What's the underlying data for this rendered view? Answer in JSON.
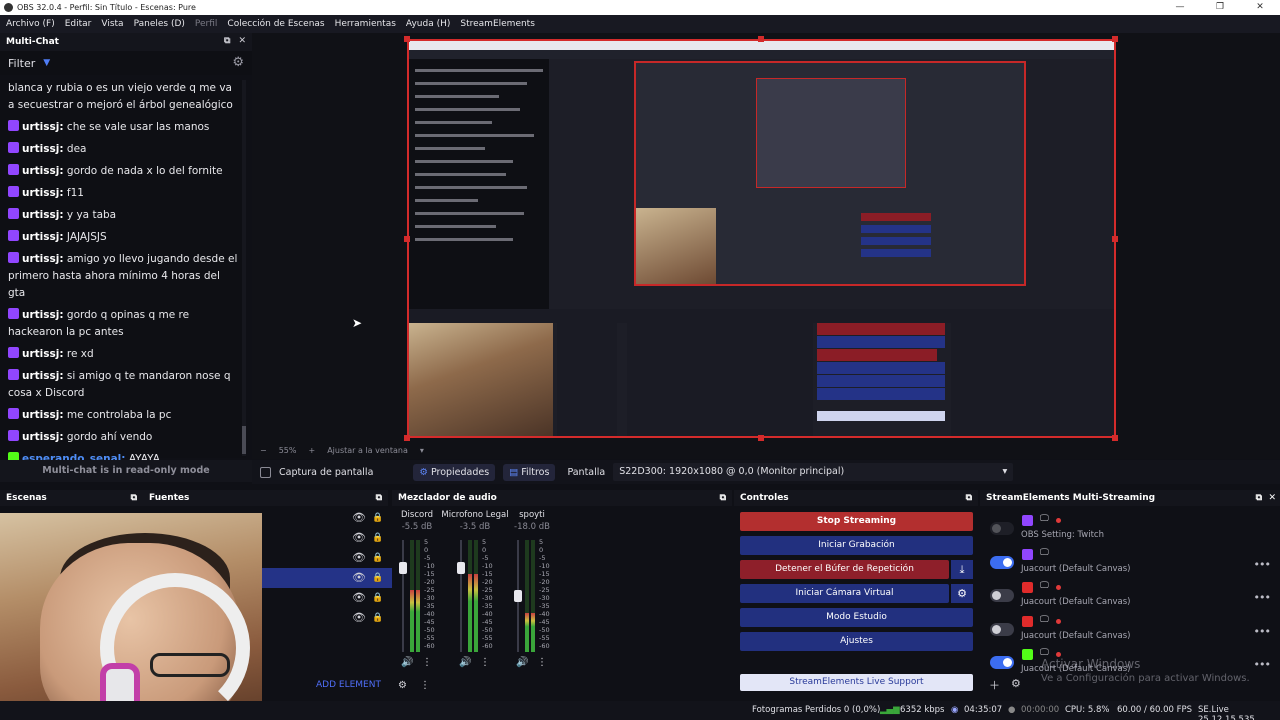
{
  "window": {
    "title": "OBS 32.0.4 - Perfil: Sin Título - Escenas: Pure"
  },
  "menu": [
    "Archivo (F)",
    "Editar",
    "Vista",
    "Paneles (D)",
    "Perfil",
    "Colección de Escenas",
    "Herramientas",
    "Ayuda (H)",
    "StreamElements"
  ],
  "multichat": {
    "title": "Multi-Chat",
    "filter_label": "Filter",
    "footer": "Multi-chat is in read-only mode",
    "messages": [
      {
        "user": "",
        "text": "blanca y rubia o es un viejo verde q me va a secuestrar o mejoró el árbol genealógico",
        "platform": "none"
      },
      {
        "user": "urtissj:",
        "text": "che se vale usar las manos",
        "platform": "twitch"
      },
      {
        "user": "urtissj:",
        "text": "dea",
        "platform": "twitch"
      },
      {
        "user": "urtissj:",
        "text": "gordo de nada x lo del fornite",
        "platform": "twitch"
      },
      {
        "user": "urtissj:",
        "text": "f11",
        "platform": "twitch"
      },
      {
        "user": "urtissj:",
        "text": "y ya taba",
        "platform": "twitch"
      },
      {
        "user": "urtissj:",
        "text": "JAJAJSJS",
        "platform": "twitch"
      },
      {
        "user": "urtissj:",
        "text": "amigo yo llevo jugando desde el primero hasta ahora mínimo 4 horas del gta",
        "platform": "twitch"
      },
      {
        "user": "urtissj:",
        "text": "gordo q opinas q me re hackearon la pc antes",
        "platform": "twitch"
      },
      {
        "user": "urtissj:",
        "text": "re xd",
        "platform": "twitch"
      },
      {
        "user": "urtissj:",
        "text": "si amigo q te mandaron nose q cosa x Discord",
        "platform": "twitch"
      },
      {
        "user": "urtissj:",
        "text": "me controlaba la pc",
        "platform": "twitch"
      },
      {
        "user": "urtissj:",
        "text": "gordo ahí vendo",
        "platform": "twitch"
      },
      {
        "user": "esperando_senal:",
        "text": "AYAYA",
        "platform": "kick"
      }
    ]
  },
  "preview_status": {
    "zoom": "55%",
    "fit": "Ajustar a la ventana"
  },
  "source_toolbar": {
    "capture_label": "Captura de pantalla",
    "properties_label": "Propiedades",
    "filters_label": "Filtros",
    "display_label": "Pantalla",
    "display_value": "S22D300: 1920x1080 @ 0,0 (Monitor principal)"
  },
  "docks": {
    "scenes": "Escenas",
    "sources": "Fuentes",
    "mixer": "Mezclador de audio",
    "controls": "Controles",
    "streamelements": "StreamElements Multi-Streaming"
  },
  "sources": {
    "add_element": "ADD ELEMENT"
  },
  "mixer": {
    "channels": [
      {
        "name": "Discord",
        "db": "-5.5 dB",
        "level": 0.55
      },
      {
        "name": "Microfono Legal",
        "db": "-3.5 dB",
        "level": 0.7
      },
      {
        "name": "spoyti",
        "db": "-18.0 dB",
        "level": 0.35
      }
    ],
    "scale": [
      "5",
      "0",
      "-5",
      "-10",
      "-15",
      "-20",
      "-25",
      "-30",
      "-35",
      "-40",
      "-45",
      "-50",
      "-55",
      "-60"
    ]
  },
  "controls": {
    "stop_streaming": "Stop Streaming",
    "start_recording": "Iniciar Grabación",
    "stop_replay": "Detener el Búfer de Repetición",
    "virtual_cam": "Iniciar Cámara Virtual",
    "studio_mode": "Modo Estudio",
    "settings": "Ajustes",
    "live_support": "StreamElements Live Support"
  },
  "streamelements": {
    "rows": [
      {
        "label": "OBS Setting: Twitch",
        "platform": "twitch",
        "enabled": false
      },
      {
        "label": "Juacourt (Default Canvas)",
        "platform": "twitch",
        "enabled": true
      },
      {
        "label": "Juacourt (Default Canvas)",
        "platform": "youtube",
        "enabled": false
      },
      {
        "label": "Juacourt (Default Canvas)",
        "platform": "youtube",
        "enabled": false
      },
      {
        "label": "Juacourt (Default Canvas)",
        "platform": "kick",
        "enabled": true
      }
    ],
    "activate_title": "Activar Windows",
    "activate_sub": "Ve a Configuración para activar Windows."
  },
  "status": {
    "frames_dropped": "Fotogramas Perdidos 0 (0,0%)",
    "bitrate": "6352 kbps",
    "stream_time": "04:35:07",
    "rec_time": "00:00:00",
    "cpu": "CPU: 5.8%",
    "fps": "60.00 / 60.00 FPS",
    "version": "SE.Live 25.12.15.535"
  },
  "colors": {
    "accent": "#4f6ef7",
    "live_red": "#b32f2f",
    "button_blue": "#22307f",
    "twitch": "#9146ff",
    "youtube": "#e02b2b",
    "kick": "#53fc18"
  }
}
